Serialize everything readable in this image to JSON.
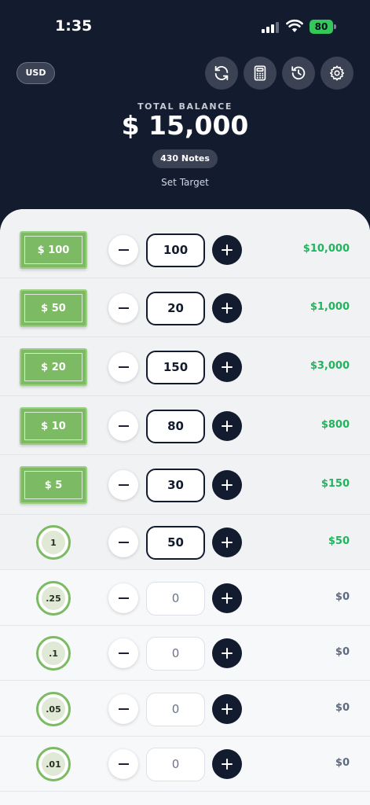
{
  "status_bar": {
    "time": "1:35",
    "battery": "80"
  },
  "header": {
    "currency": "USD",
    "icons": [
      "refresh-icon",
      "calculator-icon",
      "history-icon",
      "settings-icon"
    ],
    "total_label": "TOTAL BALANCE",
    "total_amount": "$ 15,000",
    "notes_count": "430 Notes",
    "set_target": "Set Target"
  },
  "colors": {
    "header_bg": "#131b2e",
    "accent_green": "#22b35e",
    "bill_green": "#7cba63",
    "zero_gray": "#5d6a80"
  },
  "denominations": [
    {
      "kind": "bill",
      "label": "$ 100",
      "count": "100",
      "total": "$10,000"
    },
    {
      "kind": "bill",
      "label": "$ 50",
      "count": "20",
      "total": "$1,000"
    },
    {
      "kind": "bill",
      "label": "$ 20",
      "count": "150",
      "total": "$3,000"
    },
    {
      "kind": "bill",
      "label": "$ 10",
      "count": "80",
      "total": "$800"
    },
    {
      "kind": "bill",
      "label": "$ 5",
      "count": "30",
      "total": "$150"
    },
    {
      "kind": "coin",
      "label": "1",
      "count": "50",
      "total": "$50"
    },
    {
      "kind": "coin",
      "label": ".25",
      "count": "0",
      "total": "$0"
    },
    {
      "kind": "coin",
      "label": ".1",
      "count": "0",
      "total": "$0"
    },
    {
      "kind": "coin",
      "label": ".05",
      "count": "0",
      "total": "$0"
    },
    {
      "kind": "coin",
      "label": ".01",
      "count": "0",
      "total": "$0"
    }
  ]
}
